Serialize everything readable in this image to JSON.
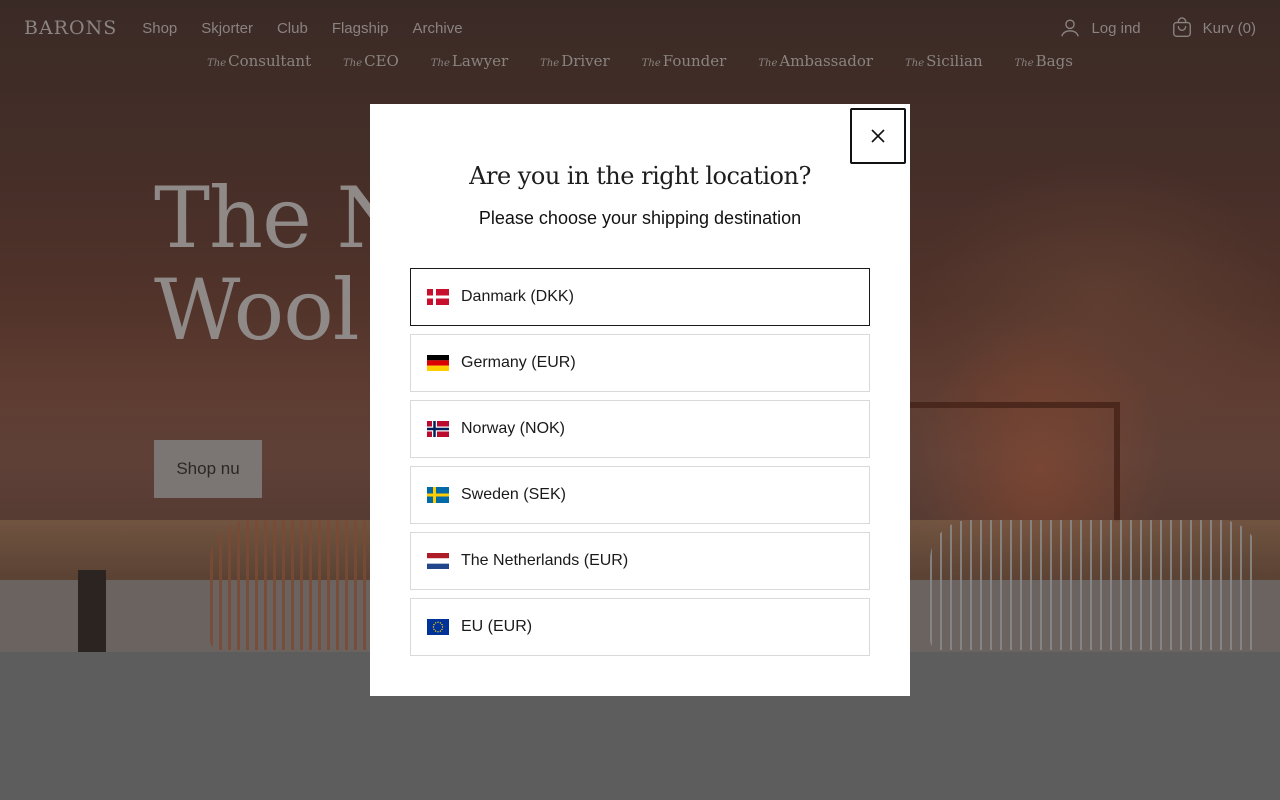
{
  "header": {
    "logo": "BARONS",
    "nav": [
      "Shop",
      "Skjorter",
      "Club",
      "Flagship",
      "Archive"
    ],
    "login_label": "Log ind",
    "cart_label": "Kurv (0)"
  },
  "collections": [
    {
      "prefix": "The",
      "name": "Consultant"
    },
    {
      "prefix": "The",
      "name": "CEO"
    },
    {
      "prefix": "The",
      "name": "Lawyer"
    },
    {
      "prefix": "The",
      "name": "Driver"
    },
    {
      "prefix": "The",
      "name": "Founder"
    },
    {
      "prefix": "The",
      "name": "Ambassador"
    },
    {
      "prefix": "The",
      "name": "Sicilian"
    },
    {
      "prefix": "The",
      "name": "Bags"
    }
  ],
  "hero": {
    "title_line1": "The Ne",
    "title_line2": "Wool C",
    "cta": "Shop nu"
  },
  "modal": {
    "title": "Are you in the right location?",
    "subtitle": "Please choose your shipping destination",
    "countries": [
      {
        "label": "Danmark (DKK)",
        "flag": "denmark-flag",
        "selected": true
      },
      {
        "label": "Germany (EUR)",
        "flag": "germany-flag",
        "selected": false
      },
      {
        "label": "Norway (NOK)",
        "flag": "norway-flag",
        "selected": false
      },
      {
        "label": "Sweden (SEK)",
        "flag": "sweden-flag",
        "selected": false
      },
      {
        "label": "The Netherlands (EUR)",
        "flag": "netherlands-flag",
        "selected": false
      },
      {
        "label": "EU (EUR)",
        "flag": "eu-flag",
        "selected": false
      }
    ]
  },
  "colors": {
    "modal_bg": "#ffffff",
    "page_dim": "#5d5d5d",
    "selected_border": "#1a1a1a",
    "option_border": "#d9d9d9"
  }
}
